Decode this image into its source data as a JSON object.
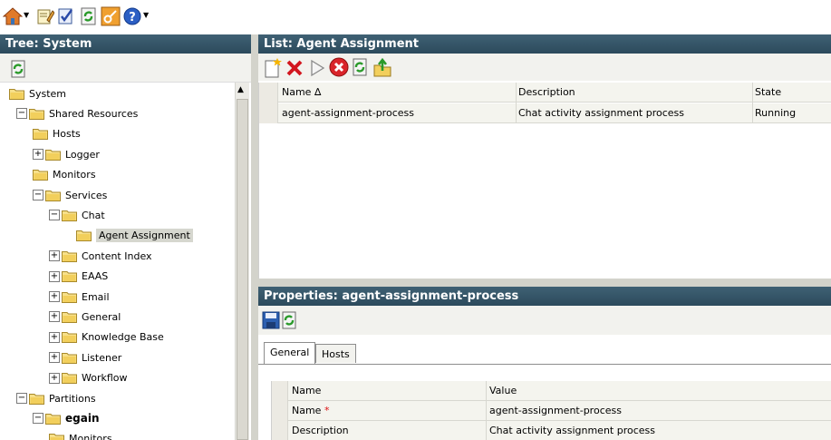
{
  "toolbar": {
    "icons": [
      "home-icon",
      "edit-document-icon",
      "checklist-icon",
      "refresh-icon",
      "key-icon",
      "help-icon"
    ]
  },
  "tree_panel": {
    "title": "Tree: System",
    "items": [
      {
        "label": "System",
        "expander": ""
      },
      {
        "label": "Shared Resources",
        "expander": "−"
      },
      {
        "label": "Hosts",
        "expander": ""
      },
      {
        "label": "Logger",
        "expander": "+"
      },
      {
        "label": "Monitors",
        "expander": ""
      },
      {
        "label": "Services",
        "expander": "−"
      },
      {
        "label": "Chat",
        "expander": "−"
      },
      {
        "label": "Agent Assignment",
        "expander": "",
        "selected": true
      },
      {
        "label": "Content Index",
        "expander": "+"
      },
      {
        "label": "EAAS",
        "expander": "+"
      },
      {
        "label": "Email",
        "expander": "+"
      },
      {
        "label": "General",
        "expander": "+"
      },
      {
        "label": "Knowledge Base",
        "expander": "+"
      },
      {
        "label": "Listener",
        "expander": "+"
      },
      {
        "label": "Workflow",
        "expander": "+"
      },
      {
        "label": "Partitions",
        "expander": "−"
      },
      {
        "label": "egain",
        "expander": "−",
        "bold": true
      },
      {
        "label": "Monitors",
        "expander": ""
      }
    ]
  },
  "list_panel": {
    "title": "List: Agent Assignment",
    "columns": [
      "Name ∆",
      "Description",
      "State"
    ],
    "rows": [
      {
        "name": "agent-assignment-process",
        "description": "Chat activity assignment process",
        "state": "Running"
      }
    ]
  },
  "properties_panel": {
    "title": "Properties: agent-assignment-process",
    "tabs": [
      "General",
      "Hosts"
    ],
    "columns": [
      "Name",
      "Value"
    ],
    "rows": [
      {
        "name": "Name",
        "required": "*",
        "value": "agent-assignment-process"
      },
      {
        "name": "Description",
        "required": "",
        "value": "Chat activity assignment process"
      }
    ]
  },
  "colors": {
    "header_bar": "#3f6174",
    "folder": "#f2cf5c",
    "selection": "#d6d7cf"
  }
}
